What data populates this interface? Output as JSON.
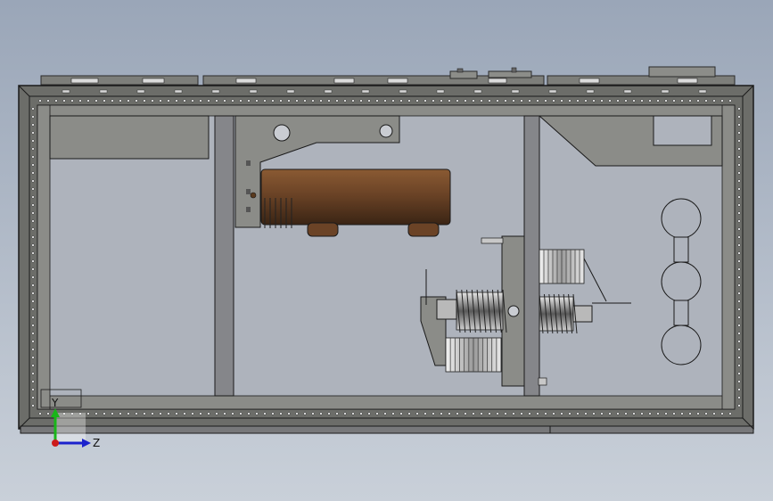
{
  "viewport": {
    "background_top": "#9aa6b8",
    "background_bottom": "#c9d0d9"
  },
  "model": {
    "frame_color": "#6f706c",
    "panel_color": "#8a8a86",
    "interior_color": "#aeb3bc",
    "coil_color": "#6b4326",
    "bellows_color": "#d8d8d8"
  },
  "triad": {
    "y_label": "Y",
    "z_label": "Z",
    "y_color": "#19b619",
    "z_color": "#1c22cc",
    "origin_color": "#cc1b1b"
  }
}
